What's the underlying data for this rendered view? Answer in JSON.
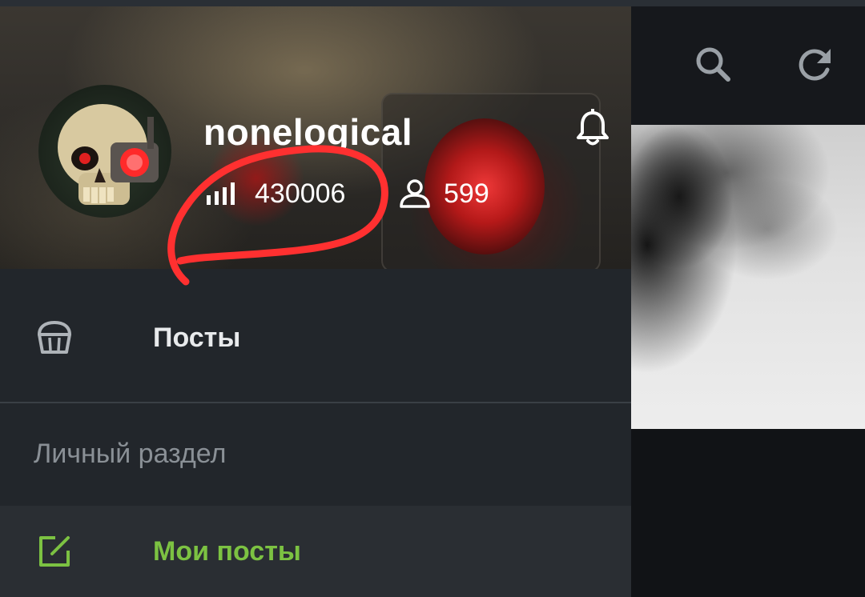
{
  "profile": {
    "username": "nonelogical",
    "rating": "430006",
    "subscribers": "599"
  },
  "menu": {
    "posts_label": "Посты",
    "section_title": "Личный раздел",
    "my_posts_label": "Мои посты"
  },
  "colors": {
    "drawer_bg": "#22262b",
    "accent_green": "#7cc242",
    "annotation_red": "#ff3030",
    "selected_item_bg": "#2a2e33"
  },
  "icons": {
    "bell": "bell-icon",
    "rating": "rating-bars-icon",
    "subscribers": "user-icon",
    "posts": "cupcake-icon",
    "my_posts": "edit-icon",
    "search": "search-icon",
    "refresh": "refresh-icon"
  }
}
